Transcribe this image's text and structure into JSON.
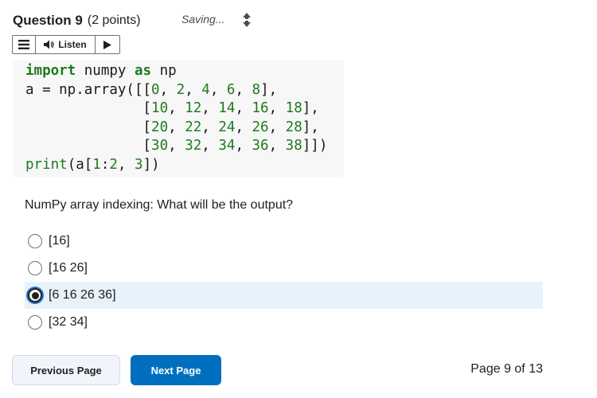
{
  "question": {
    "title": "Question 9",
    "points": "(2 points)",
    "status": "Saving..."
  },
  "listen_bar": {
    "listen_label": "Listen"
  },
  "code": {
    "lines": [
      [
        {
          "t": "import",
          "c": "kw"
        },
        {
          "t": " numpy ",
          "c": ""
        },
        {
          "t": "as",
          "c": "kw"
        },
        {
          "t": " np",
          "c": ""
        }
      ],
      [
        {
          "t": "a = np.array([[",
          "c": ""
        },
        {
          "t": "0",
          "c": "num"
        },
        {
          "t": ", ",
          "c": ""
        },
        {
          "t": "2",
          "c": "num"
        },
        {
          "t": ", ",
          "c": ""
        },
        {
          "t": "4",
          "c": "num"
        },
        {
          "t": ", ",
          "c": ""
        },
        {
          "t": "6",
          "c": "num"
        },
        {
          "t": ", ",
          "c": ""
        },
        {
          "t": "8",
          "c": "num"
        },
        {
          "t": "],",
          "c": ""
        }
      ],
      [
        {
          "t": "              [",
          "c": ""
        },
        {
          "t": "10",
          "c": "num"
        },
        {
          "t": ", ",
          "c": ""
        },
        {
          "t": "12",
          "c": "num"
        },
        {
          "t": ", ",
          "c": ""
        },
        {
          "t": "14",
          "c": "num"
        },
        {
          "t": ", ",
          "c": ""
        },
        {
          "t": "16",
          "c": "num"
        },
        {
          "t": ", ",
          "c": ""
        },
        {
          "t": "18",
          "c": "num"
        },
        {
          "t": "],",
          "c": ""
        }
      ],
      [
        {
          "t": "              [",
          "c": ""
        },
        {
          "t": "20",
          "c": "num"
        },
        {
          "t": ", ",
          "c": ""
        },
        {
          "t": "22",
          "c": "num"
        },
        {
          "t": ", ",
          "c": ""
        },
        {
          "t": "24",
          "c": "num"
        },
        {
          "t": ", ",
          "c": ""
        },
        {
          "t": "26",
          "c": "num"
        },
        {
          "t": ", ",
          "c": ""
        },
        {
          "t": "28",
          "c": "num"
        },
        {
          "t": "],",
          "c": ""
        }
      ],
      [
        {
          "t": "              [",
          "c": ""
        },
        {
          "t": "30",
          "c": "num"
        },
        {
          "t": ", ",
          "c": ""
        },
        {
          "t": "32",
          "c": "num"
        },
        {
          "t": ", ",
          "c": ""
        },
        {
          "t": "34",
          "c": "num"
        },
        {
          "t": ", ",
          "c": ""
        },
        {
          "t": "36",
          "c": "num"
        },
        {
          "t": ", ",
          "c": ""
        },
        {
          "t": "38",
          "c": "num"
        },
        {
          "t": "]])",
          "c": ""
        }
      ],
      [
        {
          "t": "print",
          "c": "fn"
        },
        {
          "t": "(a[",
          "c": ""
        },
        {
          "t": "1",
          "c": "num"
        },
        {
          "t": ":",
          "c": ""
        },
        {
          "t": "2",
          "c": "num"
        },
        {
          "t": ", ",
          "c": ""
        },
        {
          "t": "3",
          "c": "num"
        },
        {
          "t": "])",
          "c": ""
        }
      ]
    ]
  },
  "prompt": "NumPy array indexing: What will be the output?",
  "options": [
    {
      "label": "[16]",
      "selected": false
    },
    {
      "label": "[16 26]",
      "selected": false
    },
    {
      "label": "[6 16 26 36]",
      "selected": true
    },
    {
      "label": "[32 34]",
      "selected": false
    }
  ],
  "nav": {
    "prev_label": "Previous Page",
    "next_label": "Next Page",
    "page_info": "Page 9 of 13"
  },
  "colors": {
    "accent": "#006fbf",
    "code_green": "#1f7a1f",
    "selected_bg": "#e8f2fb"
  }
}
